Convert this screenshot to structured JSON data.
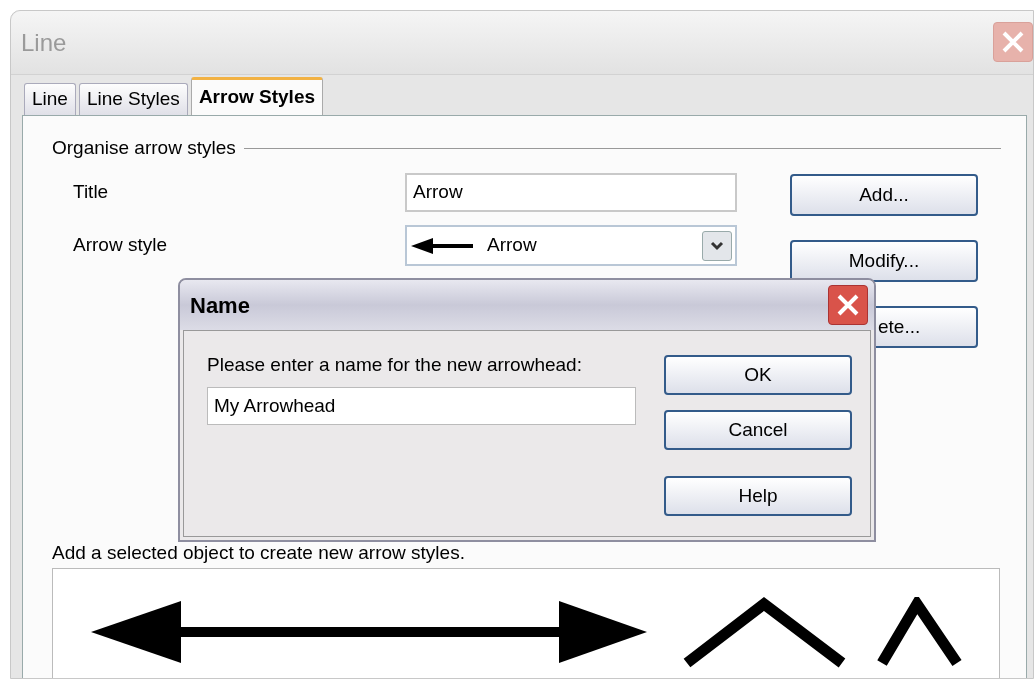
{
  "window": {
    "title": "Line"
  },
  "tabs": [
    {
      "label": "Line",
      "selected": false
    },
    {
      "label": "Line Styles",
      "selected": false
    },
    {
      "label": "Arrow Styles",
      "selected": true
    }
  ],
  "group": {
    "title": "Organise arrow styles",
    "fields": [
      {
        "kind": "text",
        "label": "Title",
        "value": "Arrow"
      },
      {
        "kind": "dropdown",
        "label": "Arrow style",
        "value": "Arrow"
      }
    ],
    "buttons": [
      "Add...",
      "Modify...",
      "ete..."
    ]
  },
  "preview": {
    "label": "Add a selected object to create new arrow styles."
  },
  "dialog": {
    "title": "Name",
    "prompt": "Please enter a name for the new arrowhead:",
    "value": "My Arrowhead",
    "buttons": [
      "OK",
      "Cancel",
      "Help"
    ]
  }
}
